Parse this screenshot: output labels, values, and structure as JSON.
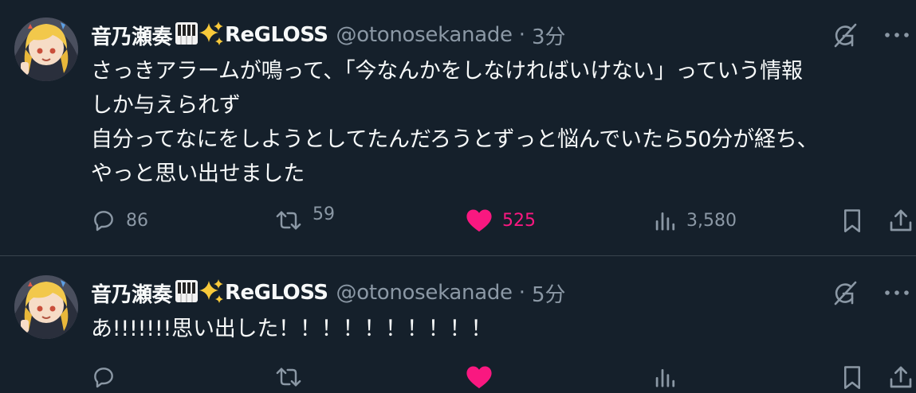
{
  "tweets": [
    {
      "display_name": "音乃瀬奏",
      "badge_text": "ReGLOSS",
      "handle": "@otonosekanade",
      "separator": "·",
      "time": "3分",
      "body": "さっきアラームが鳴って、「今なんかをしなければいけない」っていう情報\nしか与えられず\n自分ってなにをしようとしてたんだろうとずっと悩んでいたら50分が経ち、\nやっと思い出せました",
      "replies": "86",
      "retweets": "59",
      "likes": "525",
      "views": "3,580"
    },
    {
      "display_name": "音乃瀬奏",
      "badge_text": "ReGLOSS",
      "handle": "@otonosekanade",
      "separator": "·",
      "time": "5分",
      "body": "あ!!!!!!!思い出した！！！！！！！！！！"
    }
  ],
  "icons": {
    "name_emoji_1": "musical-keyboard-icon",
    "name_emoji_2": "sparkles-icon",
    "grok": "grok-icon",
    "more": "more-icon",
    "reply": "reply-icon",
    "retweet": "retweet-icon",
    "like": "heart-icon",
    "views": "views-icon",
    "bookmark": "bookmark-icon",
    "share": "share-icon"
  },
  "colors": {
    "background": "#15202b",
    "text": "#f7f9f9",
    "secondary": "#8b98a5",
    "like": "#f91880",
    "divider": "#38444d"
  }
}
